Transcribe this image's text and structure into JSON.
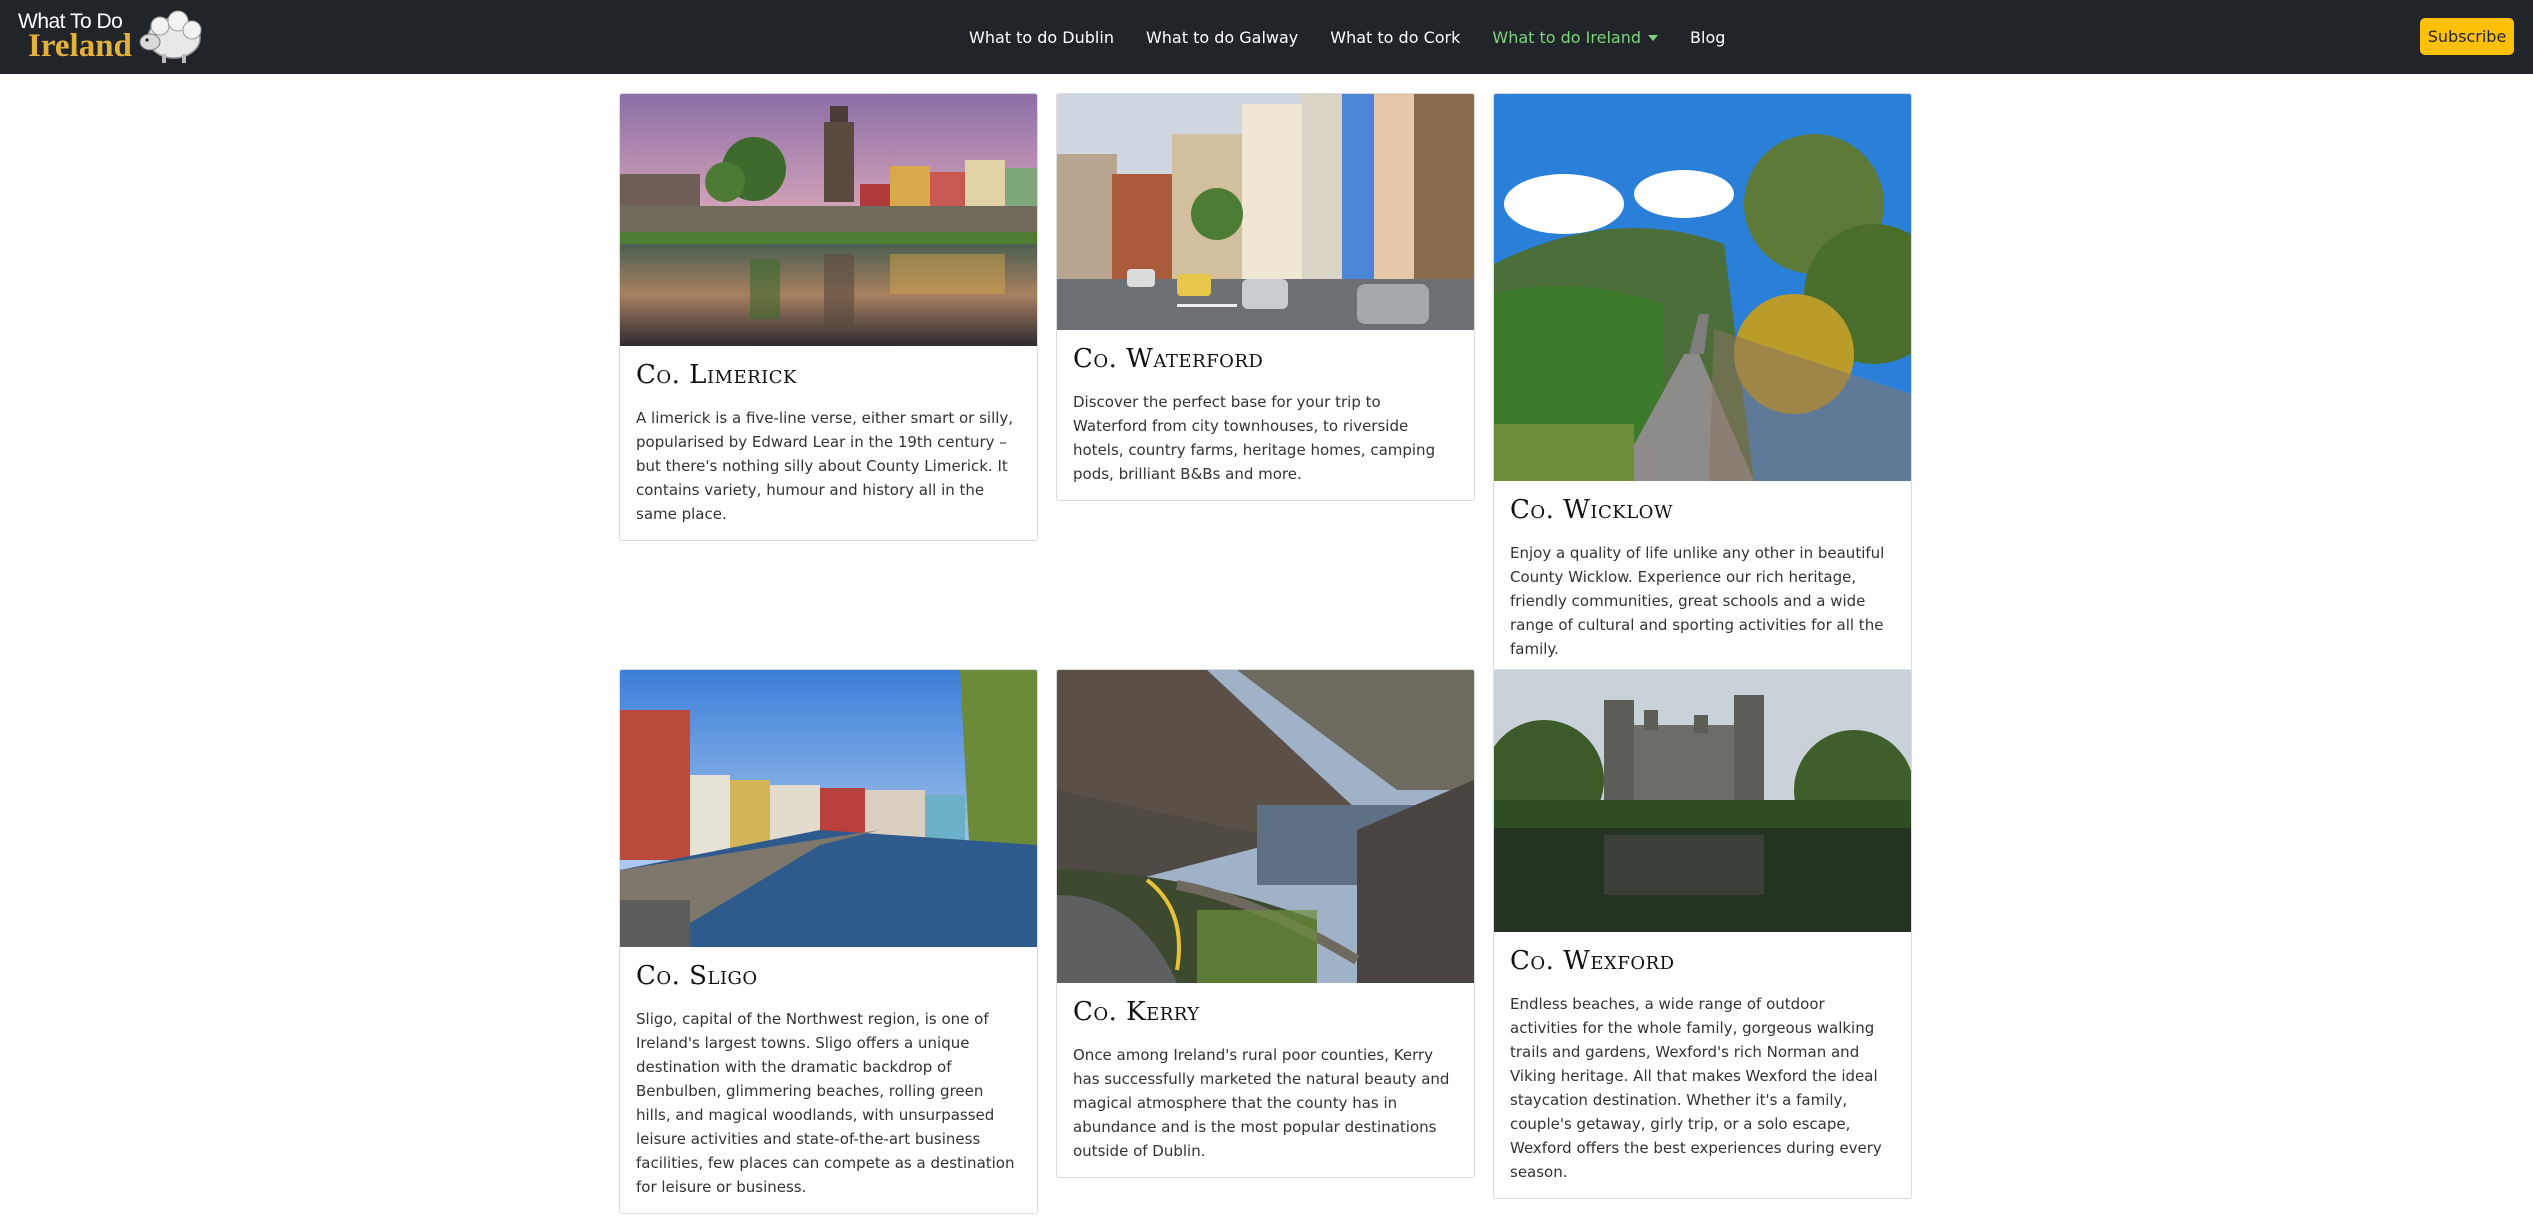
{
  "brand": {
    "line1": "What To Do",
    "line2": "Ireland"
  },
  "nav": {
    "links": [
      {
        "label": "What to do Dublin"
      },
      {
        "label": "What to do Galway"
      },
      {
        "label": "What to do Cork"
      },
      {
        "label": "What to do Ireland"
      },
      {
        "label": "Blog"
      }
    ],
    "active_color": "#7bd47b",
    "subscribe_label": "Subscribe"
  },
  "colors": {
    "navbar": "#212529",
    "subscribe": "#ffc107",
    "brand_gold": "#e3b23c"
  },
  "cards": [
    {
      "title": "Co. Limerick",
      "text": "A limerick is a five-line verse, either smart or silly, popularised by Edward Lear in the 19th century – but there's nothing silly about County Limerick. It contains variety, humour and history all in the same place.",
      "image": "river-town-cathedral-photo"
    },
    {
      "title": "Co. Waterford",
      "text": "Discover the perfect base for your trip to Waterford from city townhouses, to riverside hotels, country farms, heritage homes, camping pods, brilliant B&Bs and more.",
      "image": "colourful-street-cars-photo"
    },
    {
      "title": "Co. Wicklow",
      "text": "Enjoy a quality of life unlike any other in beautiful County Wicklow. Experience our rich heritage, friendly communities, great schools and a wide range of cultural and sporting activities for all the family.",
      "image": "boardwalk-mountain-photo"
    },
    {
      "title": "Co. Sligo",
      "text": "Sligo, capital of the Northwest region, is one of Ireland's largest towns. Sligo offers a unique destination with the dramatic backdrop of Benbulben, glimmering beaches, rolling green hills, and magical woodlands, with unsurpassed leisure activities and state-of-the-art business facilities, few places can compete as a destination for leisure or business.",
      "image": "river-promenade-photo"
    },
    {
      "title": "Co. Kerry",
      "text": "Once among Ireland's rural poor counties, Kerry has successfully marketed the natural beauty and magical atmosphere that the county has in abundance and is the most popular destinations outside of Dublin.",
      "image": "mountain-pass-lake-road-photo"
    },
    {
      "title": "Co. Wexford",
      "text": "Endless beaches, a wide range of outdoor activities for the whole family, gorgeous walking trails and gardens, Wexford's rich Norman and Viking heritage. All that makes Wexford the ideal staycation destination. Whether it's a family, couple's getaway, girly trip, or a solo escape, Wexford offers the best experiences during every season.",
      "image": "castle-lake-photo"
    }
  ]
}
